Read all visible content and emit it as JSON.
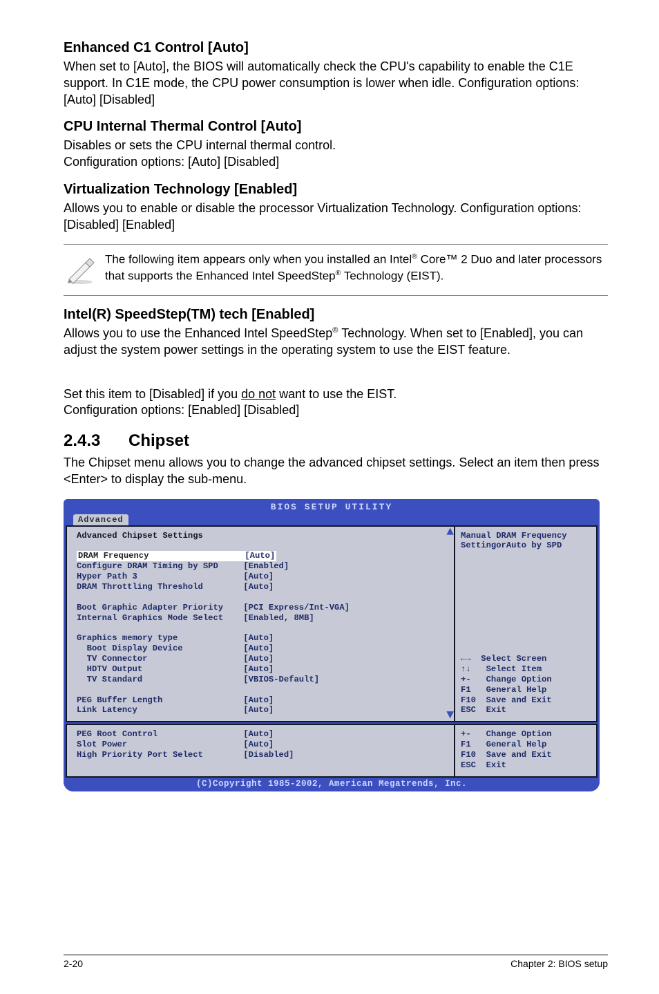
{
  "sections": {
    "s1": {
      "title": "Enhanced C1 Control [Auto]",
      "p": "When set to [Auto], the BIOS will automatically check the CPU's capability to enable the C1E support. In C1E mode, the CPU power consumption is lower when idle. Configuration options: [Auto] [Disabled]"
    },
    "s2": {
      "title": "CPU Internal Thermal Control [Auto]",
      "p": "Disables or sets the CPU internal thermal control.\nConfiguration options: [Auto] [Disabled]"
    },
    "s3": {
      "title": "Virtualization Technology [Enabled]",
      "p": "Allows you to enable or disable the processor Virtualization Technology. Configuration options: [Disabled] [Enabled]"
    },
    "note": {
      "pre": "The following item appears only when you installed an Intel",
      "mid1": " Core™ 2 Duo and later processors that supports the Enhanced Intel SpeedStep",
      "post": " Technology (EIST)."
    },
    "s4": {
      "title": "Intel(R) SpeedStep(TM) tech [Enabled]",
      "p1a": "Allows you to use the Enhanced Intel SpeedStep",
      "p1b": " Technology. When set to [Enabled], you can adjust the system power settings in the operating system to use the EIST feature.",
      "p2a": "Set this item to [Disabled] if you ",
      "p2_u": "do not",
      "p2b": " want to use the EIST.\nConfiguration options: [Enabled] [Disabled]"
    },
    "chipset": {
      "num": "2.4.3",
      "title": "Chipset",
      "p": "The Chipset menu allows you to change the advanced chipset settings. Select an item then press <Enter> to display the sub-menu."
    }
  },
  "bios": {
    "title": "BIOS SETUP UTILITY",
    "tab": "Advanced",
    "heading": "Advanced Chipset Settings",
    "rows_top": [
      {
        "label": "DRAM Frequency",
        "value": "[Auto]",
        "hi": true
      },
      {
        "label": "Configure DRAM Timing by SPD",
        "value": "[Enabled]"
      },
      {
        "label": "Hyper Path 3",
        "value": "[Auto]"
      },
      {
        "label": "DRAM Throttling Threshold",
        "value": "[Auto]"
      },
      {
        "label": "",
        "value": ""
      },
      {
        "label": "Boot Graphic Adapter Priority",
        "value": "[PCI Express/Int-VGA]"
      },
      {
        "label": "Internal Graphics Mode Select",
        "value": "[Enabled, 8MB]"
      },
      {
        "label": "",
        "value": ""
      },
      {
        "label": "Graphics memory type",
        "value": "[Auto]"
      },
      {
        "label": "  Boot Display Device",
        "value": "[Auto]"
      },
      {
        "label": "  TV Connector",
        "value": "[Auto]"
      },
      {
        "label": "  HDTV Output",
        "value": "[Auto]"
      },
      {
        "label": "  TV Standard",
        "value": "[VBIOS-Default]"
      },
      {
        "label": "",
        "value": ""
      },
      {
        "label": "PEG Buffer Length",
        "value": "[Auto]"
      },
      {
        "label": "Link Latency",
        "value": "[Auto]"
      }
    ],
    "rows_bottom": [
      {
        "label": "PEG Root Control",
        "value": "[Auto]"
      },
      {
        "label": "Slot Power",
        "value": "[Auto]"
      },
      {
        "label": "High Priority Port Select",
        "value": "[Disabled]"
      }
    ],
    "help_top": "Manual DRAM Frequency\nSettingorAuto by SPD",
    "nav_top": "←→  Select Screen\n↑↓   Select Item\n+-   Change Option\nF1   General Help\nF10  Save and Exit\nESC  Exit",
    "nav_bot": "+-   Change Option\nF1   General Help\nF10  Save and Exit\nESC  Exit",
    "foot": "(C)Copyright 1985-2002, American Megatrends, Inc."
  },
  "footer": {
    "left": "2-20",
    "right": "Chapter 2: BIOS setup"
  }
}
